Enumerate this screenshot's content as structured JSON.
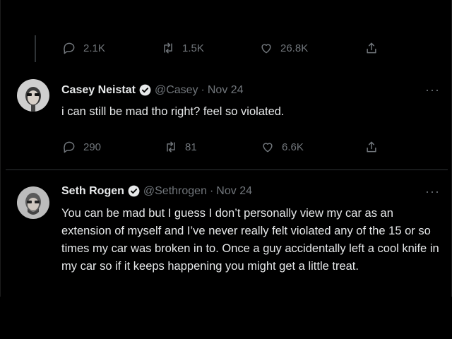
{
  "top_actions": {
    "replies": "2.1K",
    "retweets": "1.5K",
    "likes": "26.8K"
  },
  "tweets": [
    {
      "name": "Casey Neistat",
      "handle": "@Casey",
      "separator": "·",
      "date": "Nov 24",
      "verified": true,
      "text": "i can still be mad tho right?  feel so violated.",
      "replies": "290",
      "retweets": "81",
      "likes": "6.6K",
      "more": "···"
    },
    {
      "name": "Seth Rogen",
      "handle": "@Sethrogen",
      "separator": "·",
      "date": "Nov 24",
      "verified": true,
      "text": "You can be mad but I guess I don’t personally view my car as an extension of myself and I’ve never really felt violated any of the 15 or so times my car was broken in to. Once a guy accidentally left a cool knife in my car so if it keeps happening you might get a little treat.",
      "more": "···"
    }
  ],
  "colors": {
    "background": "#000000",
    "text": "#e7e9ea",
    "muted": "#71767b",
    "verified_badge": "#1d9bf0",
    "divider": "#2f3336"
  }
}
